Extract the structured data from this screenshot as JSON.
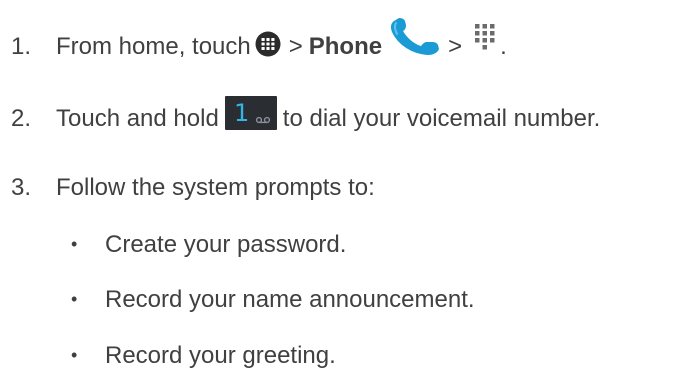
{
  "steps": [
    {
      "number": "1.",
      "text_before": "From home, touch",
      "sep1": ">",
      "bold_word": "Phone",
      "sep2": ">",
      "text_after": "."
    },
    {
      "number": "2.",
      "text_before": "Touch and hold",
      "key_label": "1",
      "text_after": "to dial your voicemail number."
    },
    {
      "number": "3.",
      "text": "Follow the system prompts to:"
    }
  ],
  "sub_items": [
    "Create your password.",
    "Record your name announcement.",
    "Record your greeting."
  ],
  "bullet": "•",
  "colors": {
    "text": "#404040",
    "phone_blue": "#1a9bd6",
    "key_background": "#2a2e33",
    "key_digit": "#33b5e5"
  },
  "icons": [
    "apps-icon",
    "phone-icon",
    "dialpad-icon",
    "voicemail-key-icon"
  ]
}
